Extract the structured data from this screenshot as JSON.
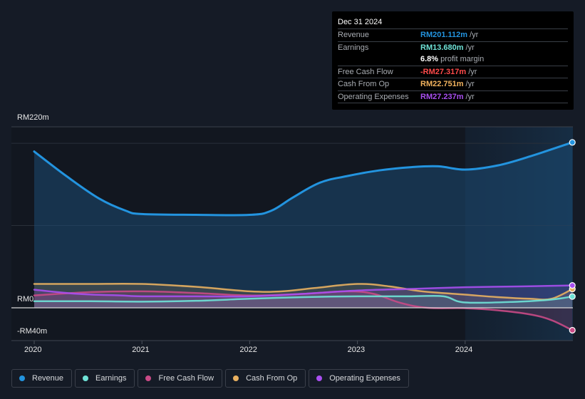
{
  "tooltip": {
    "date": "Dec 31 2024",
    "rows": [
      {
        "label": "Revenue",
        "value": "RM201.112m",
        "unit": "/yr",
        "color": "#2394df"
      },
      {
        "label": "Earnings",
        "value": "RM13.680m",
        "unit": "/yr",
        "color": "#6fe3d7"
      },
      {
        "label": "",
        "margin_value": "6.8%",
        "margin_text": "profit margin"
      },
      {
        "label": "Free Cash Flow",
        "value": "-RM27.317m",
        "unit": "/yr",
        "color": "#ff4a4a"
      },
      {
        "label": "Cash From Op",
        "value": "RM22.751m",
        "unit": "/yr",
        "color": "#f2b35e"
      },
      {
        "label": "Operating Expenses",
        "value": "RM27.237m",
        "unit": "/yr",
        "color": "#a94ff0"
      }
    ]
  },
  "legend": [
    {
      "label": "Revenue",
      "color": "#2394df"
    },
    {
      "label": "Earnings",
      "color": "#6fe3d7"
    },
    {
      "label": "Free Cash Flow",
      "color": "#c94a86"
    },
    {
      "label": "Cash From Op",
      "color": "#e8b060"
    },
    {
      "label": "Operating Expenses",
      "color": "#a94ff0"
    }
  ],
  "chart_data": {
    "type": "area",
    "title": "",
    "xlabel": "",
    "ylabel": "",
    "currency_unit": "RM (millions)",
    "y_ticks": [
      {
        "value": 220,
        "label": "RM220m"
      },
      {
        "value": 0,
        "label": "RM0"
      },
      {
        "value": -40,
        "label": "-RM40m"
      }
    ],
    "ylim": [
      -40,
      220
    ],
    "x_ticks": [
      "2020",
      "2021",
      "2022",
      "2023",
      "2024"
    ],
    "xlim": [
      2019.8,
      2025.0
    ],
    "highlight_region_start": 2024.0,
    "series": [
      {
        "name": "Revenue",
        "color": "#2394df",
        "x": [
          2020.0,
          2020.3,
          2020.6,
          2020.85,
          2021.0,
          2021.5,
          2022.0,
          2022.2,
          2022.4,
          2022.65,
          2022.9,
          2023.2,
          2023.5,
          2023.75,
          2024.0,
          2024.3,
          2024.6,
          2025.0
        ],
        "values": [
          190,
          160,
          133,
          118,
          114,
          113,
          113,
          118,
          134,
          152,
          160,
          167,
          171,
          172,
          168,
          173,
          184,
          201.1
        ]
      },
      {
        "name": "Earnings",
        "color": "#6fe3d7",
        "x": [
          2020.0,
          2020.5,
          2021.0,
          2021.5,
          2022.0,
          2022.5,
          2023.0,
          2023.5,
          2023.8,
          2024.0,
          2024.5,
          2024.8,
          2025.0
        ],
        "values": [
          8,
          8,
          7.5,
          8.5,
          11,
          13,
          14,
          14,
          14,
          6.5,
          7.5,
          10,
          13.7
        ]
      },
      {
        "name": "Free Cash Flow",
        "color": "#c94a86",
        "x": [
          2020.0,
          2020.5,
          2021.0,
          2021.5,
          2022.0,
          2022.5,
          2022.9,
          2023.15,
          2023.4,
          2023.65,
          2024.0,
          2024.3,
          2024.6,
          2024.8,
          2025.0
        ],
        "values": [
          15,
          19,
          20,
          18,
          15,
          17,
          20,
          17,
          6,
          0,
          -0.5,
          -3,
          -8,
          -15,
          -27.3
        ]
      },
      {
        "name": "Cash From Op",
        "color": "#e8b060",
        "x": [
          2020.0,
          2020.5,
          2021.0,
          2021.5,
          2022.0,
          2022.3,
          2022.6,
          2023.0,
          2023.3,
          2023.6,
          2024.0,
          2024.3,
          2024.6,
          2024.8,
          2025.0
        ],
        "values": [
          29,
          29,
          29,
          25.5,
          20,
          20,
          24,
          29,
          26,
          20,
          16,
          13,
          11,
          11,
          22.8
        ]
      },
      {
        "name": "Operating Expenses",
        "color": "#a94ff0",
        "x": [
          2020.0,
          2020.4,
          2020.8,
          2021.0,
          2021.5,
          2022.0,
          2022.5,
          2023.0,
          2023.5,
          2024.0,
          2024.5,
          2025.0
        ],
        "values": [
          22,
          17,
          15,
          14,
          14,
          14,
          17,
          21,
          23,
          25,
          26,
          27.2
        ]
      }
    ]
  }
}
